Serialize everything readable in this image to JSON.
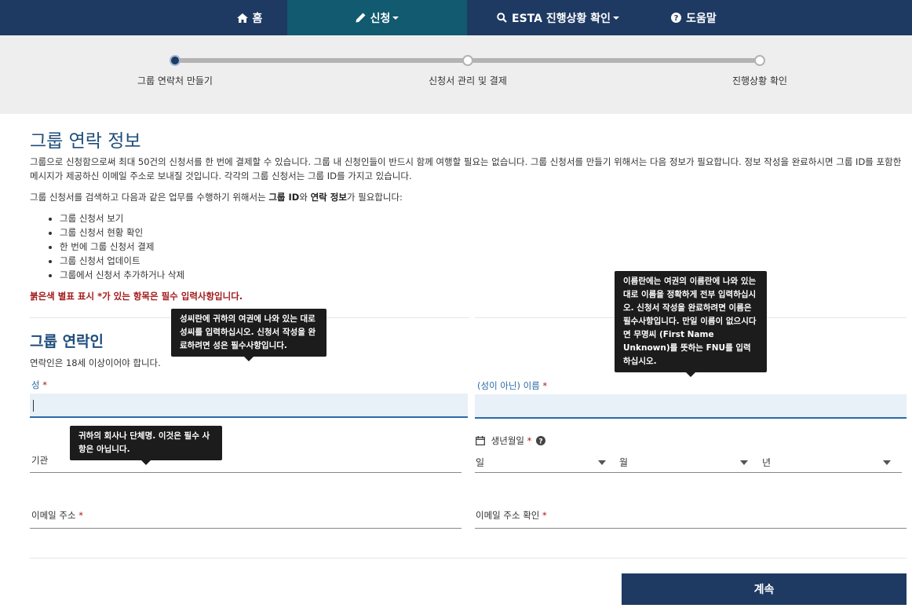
{
  "nav": {
    "home": "홈",
    "apply": "신청",
    "status": "ESTA 진행상황 확인",
    "help": "도움말"
  },
  "progress": {
    "steps": [
      "그룹 연락처 만들기",
      "신청서 관리 및 결제",
      "진행상황 확인"
    ],
    "current_step": 1
  },
  "page": {
    "title": "그룹 연락 정보",
    "intro": "그룹으로 신청함으로써 최대 50건의 신청서를 한 번에 결제할 수 있습니다. 그룹 내 신청인들이 반드시 함께 여행할 필요는 없습니다. 그룹 신청서를 만들기 위해서는 다음 정보가 필요합니다. 정보 작성을 완료하시면 그룹 ID를 포함한 메시지가 제공하신 이메일 주소로 보내질 것입니다. 각각의 그룹 신청서는 그룹 ID를 가지고 있습니다.",
    "intro2_prefix": "그룹 신청서를 검색하고 다음과 같은 업무를 수행하기 위해서는 ",
    "intro2_bold1": "그룹 ID",
    "intro2_mid": "와 ",
    "intro2_bold2": "연락 정보",
    "intro2_suffix": "가 필요합니다:",
    "bullets": [
      "그룹 신청서 보기",
      "그룹 신청서 현황 확인",
      "한 번에 그룹 신청서 결제",
      "그룹 신청서 업데이트",
      "그룹에서 신청서 추가하거나 삭제"
    ],
    "required_note": "붉은색 별표 표시 *가 있는 항목은 필수 입력사항입니다."
  },
  "contact": {
    "title": "그룹 연락인",
    "note": "연락인은 18세 이상이어야 합니다.",
    "surname_label": "성",
    "givenname_label": "(성이 아닌) 이름",
    "organization_label": "기관",
    "dob_label": "생년월일",
    "dob_day": "일",
    "dob_month": "월",
    "dob_year": "년",
    "email_label": "이메일 주소",
    "email_confirm_label": "이메일 주소 확인",
    "required_mark": "*"
  },
  "tooltips": {
    "surname": "성씨란에 귀하의 여권에 나와 있는 대로 성씨를 입력하십시오. 신청서 작성을 완료하려면 성은 필수사항입니다.",
    "givenname": "이름란에는 여권의 이름란에 나와 있는 대로 이름을 정확하게 전부 입력하십시오. 신청서 작성을 완료하려면 이름은 필수사항입니다. 만일 이름이 없으시다면 무명씨 (First Name Unknown)를 뜻하는 FNU를 입력하십시오.",
    "organization": "귀하의 회사나 단체명. 이것은 필수 사항은 아닙니다."
  },
  "buttons": {
    "continue": "계속"
  },
  "colors": {
    "navy": "#1e3a62",
    "active_nav": "#115a6f",
    "required_red": "#a31a1a",
    "title_blue": "#1e4d7b"
  }
}
